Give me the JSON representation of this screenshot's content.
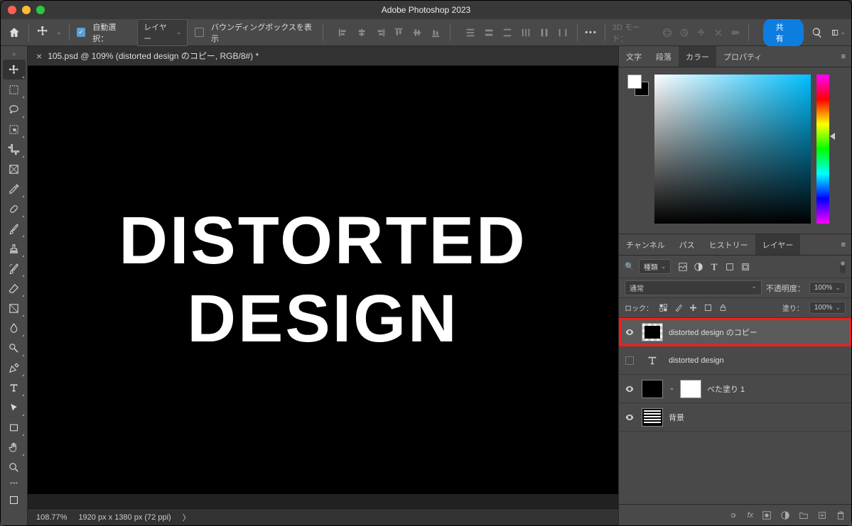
{
  "titlebar": {
    "title": "Adobe Photoshop 2023"
  },
  "optbar": {
    "auto_select_label": "自動選択：",
    "layer_select": "レイヤー",
    "bounding_label": "バウンディングボックスを表示",
    "threed_label": "3D モード：",
    "share_label": "共有"
  },
  "tab": {
    "title": "105.psd @ 109% (distorted design のコピー, RGB/8#) *"
  },
  "canvas": {
    "text1": "DISTORTED",
    "text2": "DESIGN"
  },
  "statusbar": {
    "zoom": "108.77%",
    "dims": "1920 px x 1380 px (72 ppi)"
  },
  "top_panel_tabs": [
    "文字",
    "段落",
    "カラー",
    "プロパティ"
  ],
  "bottom_panel_tabs": [
    "チャンネル",
    "パス",
    "ヒストリー",
    "レイヤー"
  ],
  "layer_panel": {
    "filter_label": "種類",
    "blend_mode": "通常",
    "opacity_label": "不透明度：",
    "opacity_value": "100%",
    "lock_label": "ロック：",
    "fill_label": "塗り：",
    "fill_value": "100%",
    "layers": [
      {
        "name": "distorted design のコピー",
        "visible": true,
        "highlighted": true,
        "selected": true,
        "thumb": "checker"
      },
      {
        "name": "distorted design",
        "visible": false,
        "thumb": "text"
      },
      {
        "name": "べた塗り 1",
        "visible": true,
        "thumb": "solid"
      },
      {
        "name": "背景",
        "visible": true,
        "thumb": "bg"
      }
    ],
    "bottom_fx_label": "fx"
  },
  "search_placeholder": "種類"
}
